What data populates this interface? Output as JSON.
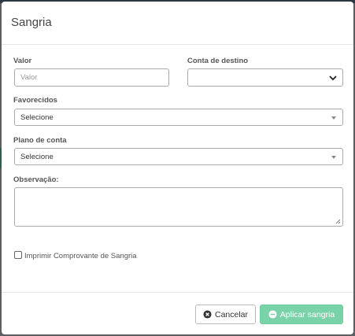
{
  "modal": {
    "title": "Sangria"
  },
  "form": {
    "valor": {
      "label": "Valor",
      "placeholder": "Valor"
    },
    "conta_destino": {
      "label": "Conta de destino",
      "value": ""
    },
    "favorecidos": {
      "label": "Favorecidos",
      "value": "Selecione"
    },
    "plano_conta": {
      "label": "Plano de conta",
      "value": "Selecione"
    },
    "observacao": {
      "label": "Observação:",
      "value": ""
    },
    "imprimir": {
      "label": "Imprimir Comprovante de Sangria",
      "checked": false
    }
  },
  "footer": {
    "cancel_label": "Cancelar",
    "apply_label": "Aplicar sangria"
  },
  "colors": {
    "apply_button": "#7ad3a8",
    "backdrop": "#5b5f63"
  },
  "icons": {
    "cancel": "times-circle-icon",
    "apply": "minus-circle-icon",
    "select": "chevron-down-icon"
  }
}
